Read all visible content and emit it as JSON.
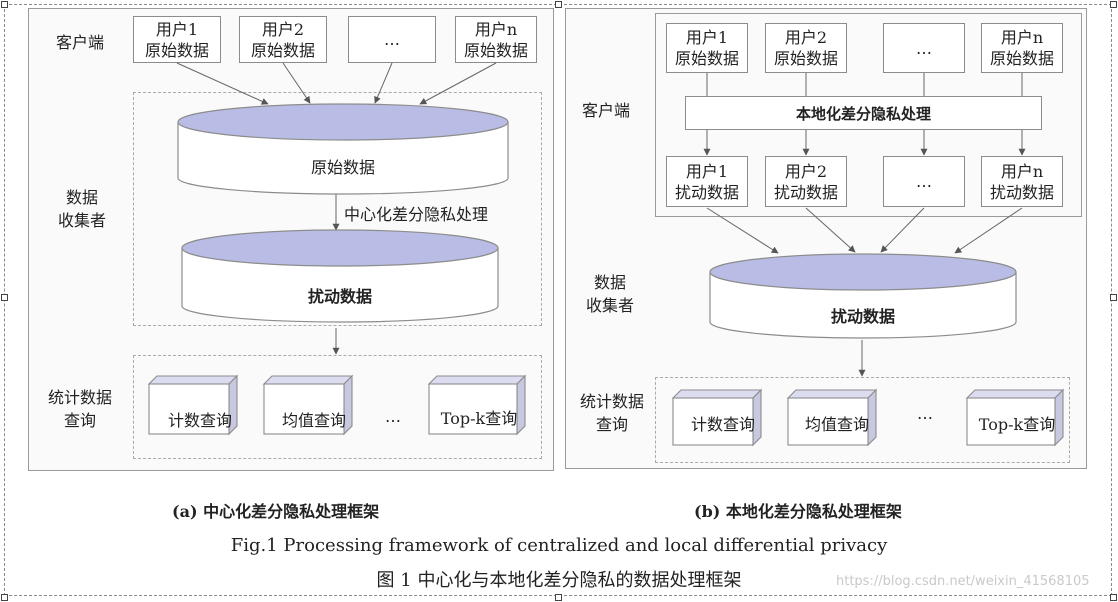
{
  "panel_a": {
    "client_label": "客户端",
    "users": [
      {
        "line1": "用户1",
        "line2": "原始数据"
      },
      {
        "line1": "用户2",
        "line2": "原始数据"
      },
      {
        "line1": "…",
        "line2": ""
      },
      {
        "line1": "用户n",
        "line2": "原始数据"
      }
    ],
    "collector_label": "数据\n收集者",
    "db_raw": "原始数据",
    "process_label": "中心化差分隐私处理",
    "db_perturbed": "扰动数据",
    "stats_label": "统计数据\n查询",
    "queries": [
      "计数查询",
      "均值查询",
      "…",
      "Top-k查询"
    ],
    "caption": "(a) 中心化差分隐私处理框架"
  },
  "panel_b": {
    "client_label": "客户端",
    "users_raw": [
      {
        "line1": "用户1",
        "line2": "原始数据"
      },
      {
        "line1": "用户2",
        "line2": "原始数据"
      },
      {
        "line1": "…",
        "line2": ""
      },
      {
        "line1": "用户n",
        "line2": "原始数据"
      }
    ],
    "local_process": "本地化差分隐私处理",
    "users_perturbed": [
      {
        "line1": "用户1",
        "line2": "扰动数据"
      },
      {
        "line1": "用户2",
        "line2": "扰动数据"
      },
      {
        "line1": "…",
        "line2": ""
      },
      {
        "line1": "用户n",
        "line2": "扰动数据"
      }
    ],
    "collector_label": "数据\n收集者",
    "db_perturbed": "扰动数据",
    "stats_label": "统计数据\n查询",
    "queries": [
      "计数查询",
      "均值查询",
      "…",
      "Top-k查询"
    ],
    "caption": "(b) 本地化差分隐私处理框架"
  },
  "figure": {
    "caption_en": "Fig.1    Processing framework of centralized and local differential privacy",
    "caption_zh": "图 1    中心化与本地化差分隐私的数据处理框架",
    "watermark": "https://blog.csdn.net/weixin_41568105"
  },
  "colors": {
    "db_top": "#b9bde6",
    "border": "#8c8c8c",
    "arrow": "#555555"
  }
}
